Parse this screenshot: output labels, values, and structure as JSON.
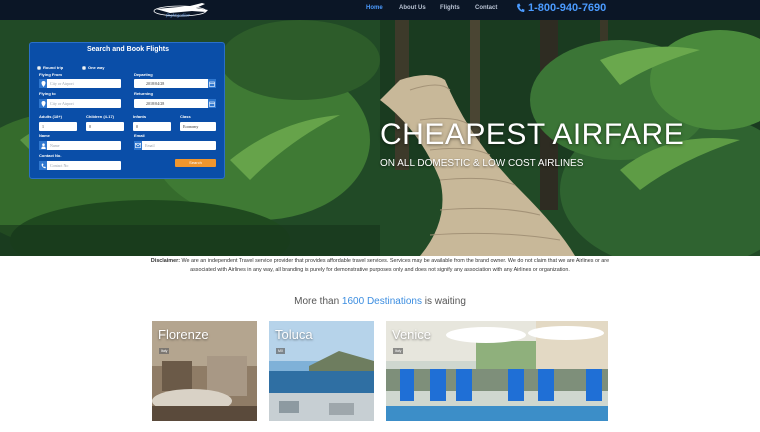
{
  "nav": {
    "brand": "flightgoiller",
    "items": [
      {
        "label": "Home",
        "active": true
      },
      {
        "label": "About Us",
        "active": false
      },
      {
        "label": "Flights",
        "active": false
      },
      {
        "label": "Contact",
        "active": false
      }
    ],
    "phone": "1-800-940-7690",
    "phone_icon": "phone-icon"
  },
  "hero": {
    "title": "CHEAPEST AIRFARE",
    "subtitle": "ON ALL DOMESTIC & LOW COST AIRLINES"
  },
  "booking": {
    "title": "Search and Book Flights",
    "trip_round": "Round trip",
    "trip_oneway": "One way",
    "flying_from_label": "Flying From",
    "flying_from_placeholder": "City or Airport",
    "departing_label": "Departing",
    "departing_value": "2018/04/28",
    "flying_to_label": "Flying to",
    "flying_to_placeholder": "City or Airport",
    "returning_label": "Returning",
    "returning_value": "2018/04/28",
    "adults_label": "Adults (18+)",
    "adults_value": "1",
    "children_label": "Children (4-17)",
    "children_value": "0",
    "infants_label": "Infants",
    "infants_value": "0",
    "class_label": "Class",
    "class_value": "Economy",
    "name_label": "Name",
    "name_placeholder": "Name",
    "email_label": "Email",
    "email_placeholder": "Email",
    "contact_label": "Contact No.",
    "contact_placeholder": "Contact No",
    "search_label": "Search"
  },
  "disclaimer": {
    "lead": "Disclaimer:",
    "text": " We are an independent Travel service provider that provides affordable travel services. Services may be available from the brand owner. We do not claim that we are Airlines or are associated with Airlines in any way, all branding is purely for demonstrative purposes only and does not signify any association with any Airlines or organization."
  },
  "destinations": {
    "prefix": "More than ",
    "count": "1600 Destinations",
    "suffix": " is waiting",
    "cards": [
      {
        "city": "Florenze",
        "tag": "Italy"
      },
      {
        "city": "Toluca",
        "tag": "MX"
      },
      {
        "city": "Venice",
        "tag": "Italy"
      }
    ]
  },
  "colors": {
    "nav_bg": "#0b1626",
    "accent": "#4b9bff",
    "panel_bg": "#0a4ea8",
    "button": "#f0962e"
  }
}
